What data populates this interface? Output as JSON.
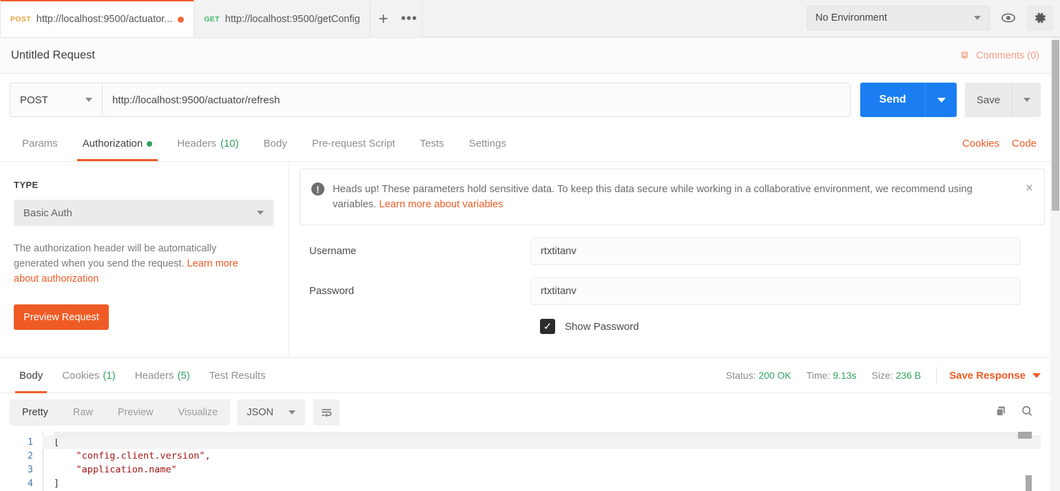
{
  "tabs": [
    {
      "method": "POST",
      "url": "http://localhost:9500/actuator...",
      "active": true,
      "unsaved": true
    },
    {
      "method": "GET",
      "url": "http://localhost:9500/getConfig",
      "active": false,
      "unsaved": false
    }
  ],
  "tabbar": {
    "new_tab_label": "+",
    "more_label": "•••"
  },
  "environment": {
    "selected": "No Environment",
    "eye_icon": "eye-icon",
    "gear_icon": "gear-icon"
  },
  "request": {
    "title": "Untitled Request",
    "comments_label": "Comments (0)",
    "method": "POST",
    "url": "http://localhost:9500/actuator/refresh",
    "send_label": "Send",
    "save_label": "Save"
  },
  "request_tabs": [
    {
      "label": "Params",
      "active": false,
      "badge": "",
      "dot": false
    },
    {
      "label": "Authorization",
      "active": true,
      "badge": "",
      "dot": true
    },
    {
      "label": "Headers",
      "active": false,
      "badge": "(10)",
      "dot": false
    },
    {
      "label": "Body",
      "active": false,
      "badge": "",
      "dot": false
    },
    {
      "label": "Pre-request Script",
      "active": false,
      "badge": "",
      "dot": false
    },
    {
      "label": "Tests",
      "active": false,
      "badge": "",
      "dot": false
    },
    {
      "label": "Settings",
      "active": false,
      "badge": "",
      "dot": false
    }
  ],
  "request_tabs_right": {
    "cookies": "Cookies",
    "code": "Code"
  },
  "auth": {
    "type_heading": "TYPE",
    "type_value": "Basic Auth",
    "description": "The authorization header will be automatically generated when you send the request. ",
    "description_link": "Learn more about authorization",
    "preview_button": "Preview Request"
  },
  "banner": {
    "text_before": "Heads up! These parameters hold sensitive data. To keep this data secure while working in a collaborative environment, we recommend using variables. ",
    "link": "Learn more about variables",
    "close_label": "×",
    "icon": "warning-icon"
  },
  "credentials": {
    "username_label": "Username",
    "username_value": "rtxtitanv",
    "password_label": "Password",
    "password_value": "rtxtitanv",
    "show_password_label": "Show Password",
    "show_password_checked": true,
    "check_glyph": "✓"
  },
  "response_tabs": [
    {
      "label": "Body",
      "active": true,
      "badge": ""
    },
    {
      "label": "Cookies",
      "active": false,
      "badge": "(1)"
    },
    {
      "label": "Headers",
      "active": false,
      "badge": "(5)"
    },
    {
      "label": "Test Results",
      "active": false,
      "badge": ""
    }
  ],
  "response_meta": {
    "status_label": "Status:",
    "status_value": "200 OK",
    "time_label": "Time:",
    "time_value": "9.13s",
    "size_label": "Size:",
    "size_value": "236 B",
    "save_response_label": "Save Response"
  },
  "viewer": {
    "modes": [
      {
        "label": "Pretty",
        "active": true
      },
      {
        "label": "Raw",
        "active": false
      },
      {
        "label": "Preview",
        "active": false
      },
      {
        "label": "Visualize",
        "active": false
      }
    ],
    "format": "JSON",
    "wrap_icon": "wrap-lines-icon",
    "copy_icon": "copy-icon",
    "search_icon": "search-icon"
  },
  "response_body": {
    "lines": [
      {
        "no": "1",
        "text": "["
      },
      {
        "no": "2",
        "text": "    \"config.client.version\","
      },
      {
        "no": "3",
        "text": "    \"application.name\""
      },
      {
        "no": "4",
        "text": "]"
      }
    ]
  },
  "colors": {
    "accent_orange": "#ef5b25",
    "send_blue": "#1a7ef2",
    "success_green": "#2fa360",
    "post_method": "#e9a33b",
    "get_method": "#3eb86c",
    "string_red": "#a31515"
  }
}
